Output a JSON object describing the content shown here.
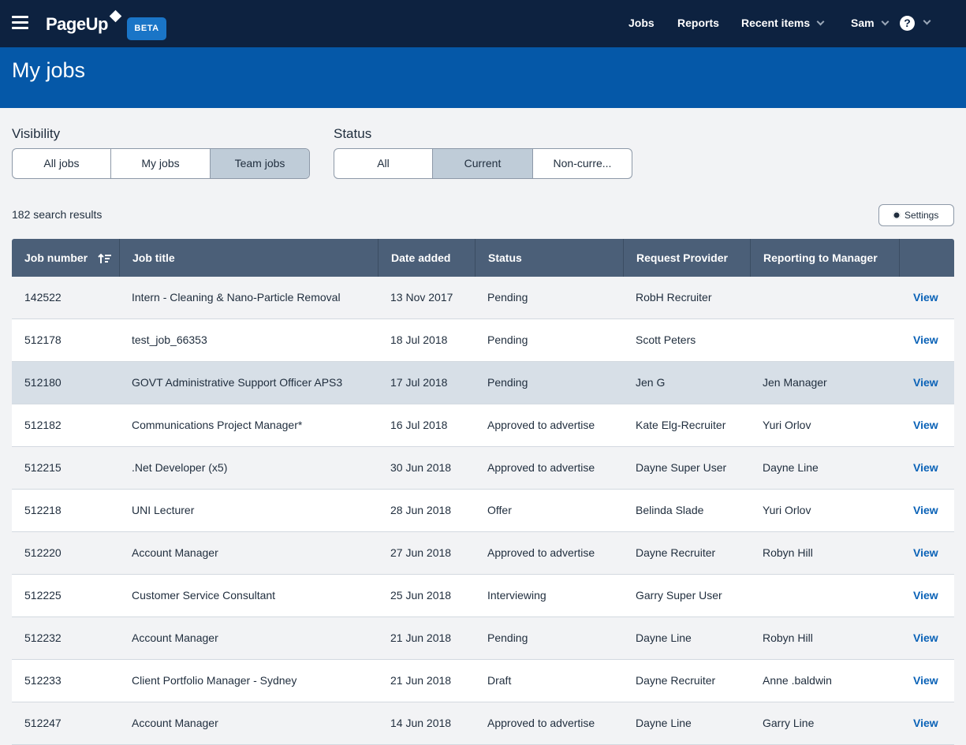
{
  "app": {
    "logo": "PageUp",
    "badge": "BETA"
  },
  "nav": {
    "jobs": "Jobs",
    "reports": "Reports",
    "recent": "Recent items",
    "user": "Sam",
    "help": "?"
  },
  "page": {
    "title": "My jobs"
  },
  "visibility": {
    "label": "Visibility",
    "options": [
      "All jobs",
      "My jobs",
      "Team jobs"
    ],
    "selected": "Team jobs"
  },
  "status_filter": {
    "label": "Status",
    "options": [
      "All",
      "Current",
      "Non-curre..."
    ],
    "selected": "Current"
  },
  "results": {
    "count_text": "182 search results",
    "settings_label": "Settings"
  },
  "table": {
    "headers": [
      "Job number",
      "Job title",
      "Date added",
      "Status",
      "Request Provider",
      "Reporting to Manager",
      ""
    ],
    "rows": [
      {
        "num": "142522",
        "title": "Intern - Cleaning & Nano-Particle Removal",
        "date": "13 Nov 2017",
        "status": "Pending",
        "provider": "RobH Recruiter",
        "manager": "",
        "action": "View"
      },
      {
        "num": "512178",
        "title": "test_job_66353",
        "date": "18 Jul 2018",
        "status": "Pending",
        "provider": "Scott Peters",
        "manager": "",
        "action": "View"
      },
      {
        "num": "512180",
        "title": "GOVT Administrative Support Officer APS3",
        "date": "17 Jul 2018",
        "status": "Pending",
        "provider": "Jen G",
        "manager": "Jen Manager",
        "action": "View"
      },
      {
        "num": "512182",
        "title": "Communications Project Manager*",
        "date": "16 Jul 2018",
        "status": "Approved to advertise",
        "provider": "Kate Elg-Recruiter",
        "manager": "Yuri Orlov",
        "action": "View"
      },
      {
        "num": "512215",
        "title": ".Net Developer (x5)",
        "date": "30 Jun 2018",
        "status": "Approved to advertise",
        "provider": "Dayne Super User",
        "manager": "Dayne Line",
        "action": "View"
      },
      {
        "num": "512218",
        "title": "UNI Lecturer",
        "date": "28 Jun 2018",
        "status": "Offer",
        "provider": "Belinda Slade",
        "manager": "Yuri Orlov",
        "action": "View"
      },
      {
        "num": "512220",
        "title": "Account Manager",
        "date": "27 Jun 2018",
        "status": "Approved to advertise",
        "provider": "Dayne Recruiter",
        "manager": "Robyn Hill",
        "action": "View"
      },
      {
        "num": "512225",
        "title": "Customer Service Consultant",
        "date": "25 Jun 2018",
        "status": "Interviewing",
        "provider": "Garry Super User",
        "manager": "",
        "action": "View"
      },
      {
        "num": "512232",
        "title": "Account Manager",
        "date": "21 Jun 2018",
        "status": "Pending",
        "provider": "Dayne Line",
        "manager": "Robyn Hill",
        "action": "View"
      },
      {
        "num": "512233",
        "title": "Client Portfolio Manager - Sydney",
        "date": "21 Jun 2018",
        "status": "Draft",
        "provider": "Dayne Recruiter",
        "manager": "Anne .baldwin",
        "action": "View"
      },
      {
        "num": "512247",
        "title": "Account Manager",
        "date": "14 Jun 2018",
        "status": "Approved to advertise",
        "provider": "Dayne Line",
        "manager": "Garry Line",
        "action": "View"
      }
    ]
  },
  "colors": {
    "topbar": "#0d2240",
    "banner": "#0558a8",
    "header": "#4b5f78",
    "link": "#0a62b7",
    "active_segment": "#bfccd8"
  },
  "icons": {
    "menu": "hamburger-icon",
    "help": "help-icon",
    "settings": "gear-icon",
    "sort": "sort-ascending-icon"
  }
}
